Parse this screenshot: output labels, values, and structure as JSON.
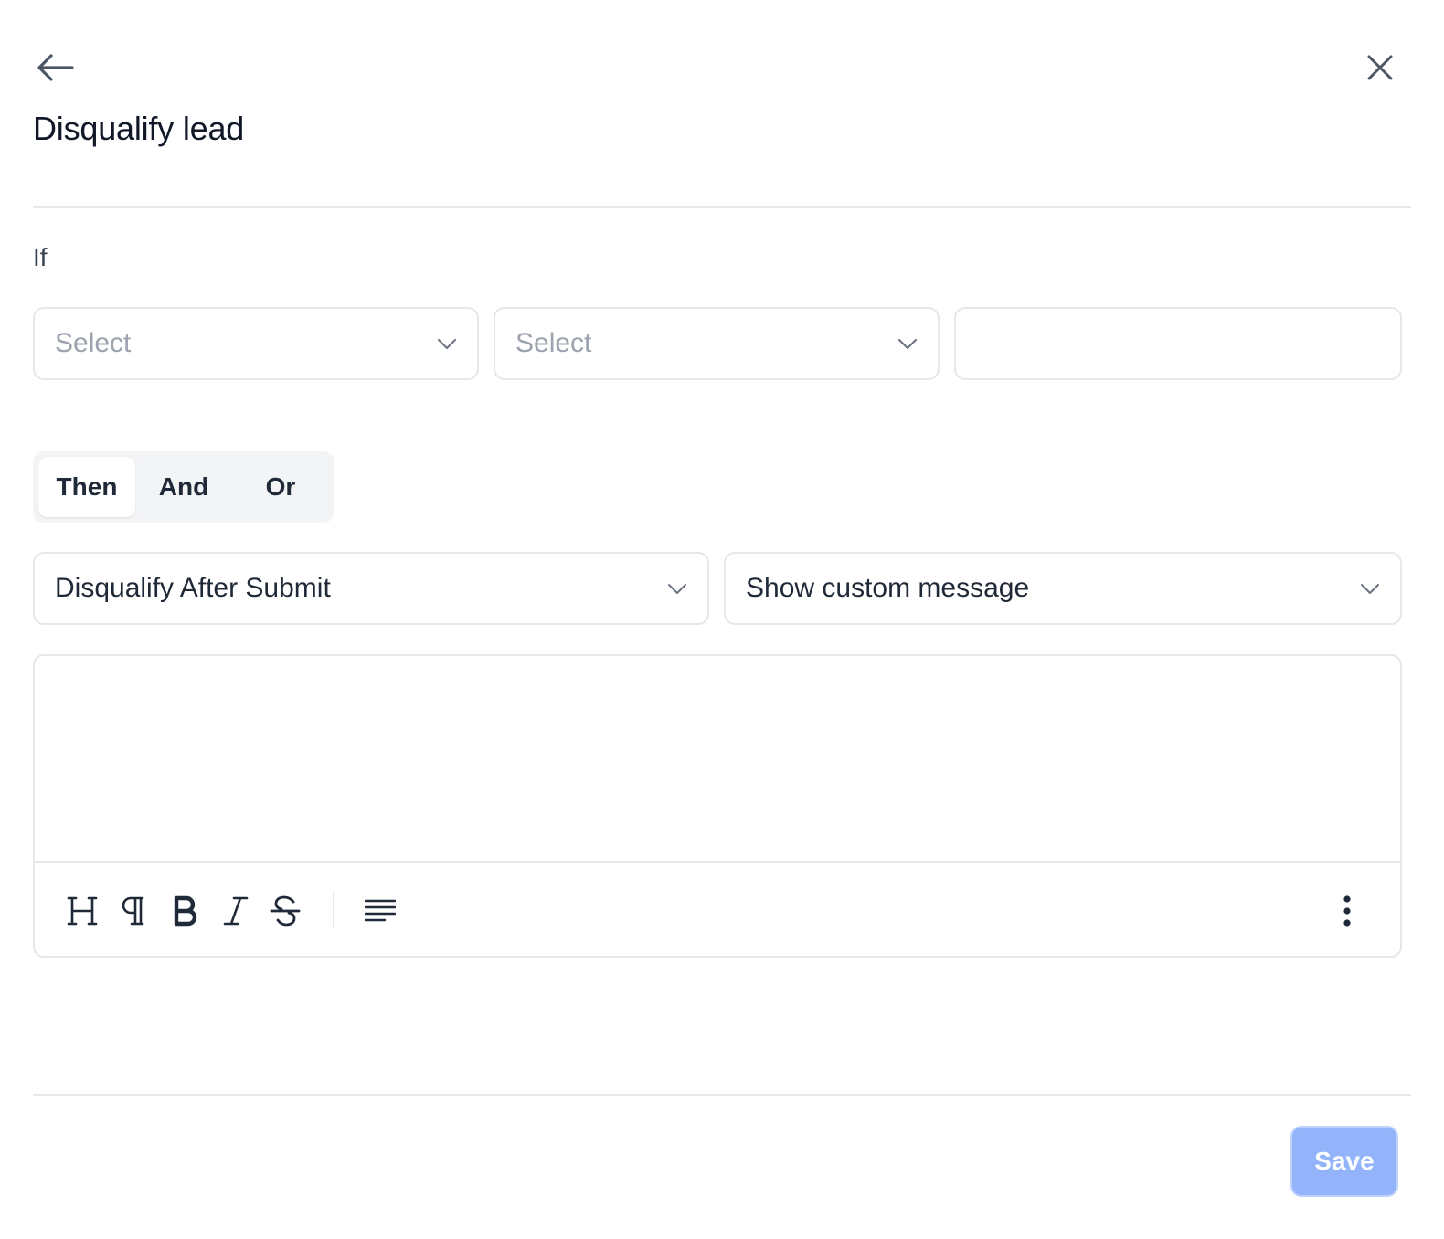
{
  "header": {
    "back_icon": "arrow-left-icon",
    "close_icon": "close-icon",
    "title": "Disqualify lead"
  },
  "condition": {
    "label": "If",
    "field_select": {
      "placeholder": "Select",
      "value": ""
    },
    "operator_select": {
      "placeholder": "Select",
      "value": ""
    },
    "value_input": {
      "value": ""
    }
  },
  "logic_toggle": {
    "options": [
      "Then",
      "And",
      "Or"
    ],
    "selected": "Then"
  },
  "action": {
    "type_select": {
      "value": "Disqualify After Submit"
    },
    "behavior_select": {
      "value": "Show custom message"
    }
  },
  "editor": {
    "content": "",
    "toolbar": [
      "heading-icon",
      "paragraph-icon",
      "bold-icon",
      "italic-icon",
      "strikethrough-icon",
      "align-left-icon",
      "more-vertical-icon"
    ]
  },
  "footer": {
    "save_label": "Save"
  },
  "colors": {
    "accent_disabled": "#93b4fb",
    "border": "#e5e7eb",
    "text": "#1f2937",
    "placeholder": "#9ca3af"
  }
}
